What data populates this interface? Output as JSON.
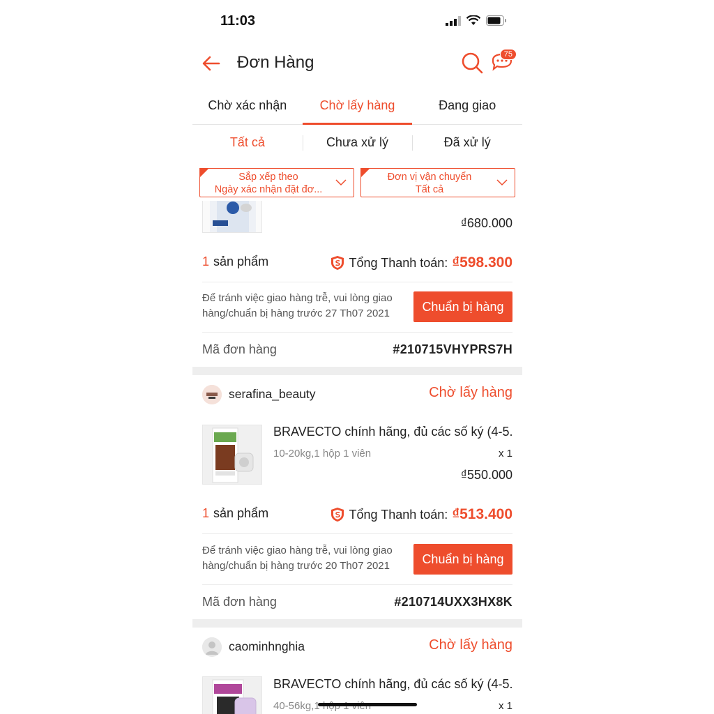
{
  "status_bar": {
    "time": "11:03"
  },
  "header": {
    "title": "Đơn Hàng",
    "chat_badge": "75"
  },
  "tabs": [
    {
      "label": "Chờ xác nhận",
      "active": false
    },
    {
      "label": "Chờ lấy hàng",
      "active": true
    },
    {
      "label": "Đang giao",
      "active": false
    }
  ],
  "subtabs": [
    {
      "label": "Tất cả",
      "active": true
    },
    {
      "label": "Chưa xử lý",
      "active": false
    },
    {
      "label": "Đã xử lý",
      "active": false
    }
  ],
  "filters": {
    "sort": {
      "line1": "Sắp xếp theo",
      "line2": "Ngày xác nhận đặt đơ..."
    },
    "carrier": {
      "line1": "Đơn vị vận chuyển",
      "line2": "Tất cả"
    }
  },
  "orders": [
    {
      "price": "₫680.000",
      "count_num": "1",
      "count_label": "sản phẩm",
      "total_label": "Tổng Thanh toán:",
      "total_amount": "₫598.300",
      "note": "Để tránh việc giao hàng trễ, vui lòng giao hàng/chuẩn bị hàng trước 27 Th07 2021",
      "button": "Chuẩn bị hàng",
      "id_label": "Mã đơn hàng",
      "id_value": "#210715VHYPRS7H"
    },
    {
      "shop": "serafina_beauty",
      "status": "Chờ lấy hàng",
      "product_name": "BRAVECTO chính hãng, đủ các số ký (4-5...",
      "variant": "10-20kg,1 hộp 1 viên",
      "qty": "x 1",
      "price": "₫550.000",
      "count_num": "1",
      "count_label": "sản phẩm",
      "total_label": "Tổng Thanh toán:",
      "total_amount": "₫513.400",
      "note": "Để tránh việc giao hàng trễ, vui lòng giao hàng/chuẩn bị hàng trước 20 Th07 2021",
      "button": "Chuẩn bị hàng",
      "id_label": "Mã đơn hàng",
      "id_value": "#210714UXX3HX8K"
    },
    {
      "shop": "caominhnghia",
      "status": "Chờ lấy hàng",
      "product_name": "BRAVECTO chính hãng, đủ các số ký (4-5...",
      "variant": "40-56kg,1 hộp 1 viên",
      "qty": "x 1"
    }
  ],
  "colors": {
    "accent": "#ee4d2d",
    "gap": "#eeeeee"
  }
}
